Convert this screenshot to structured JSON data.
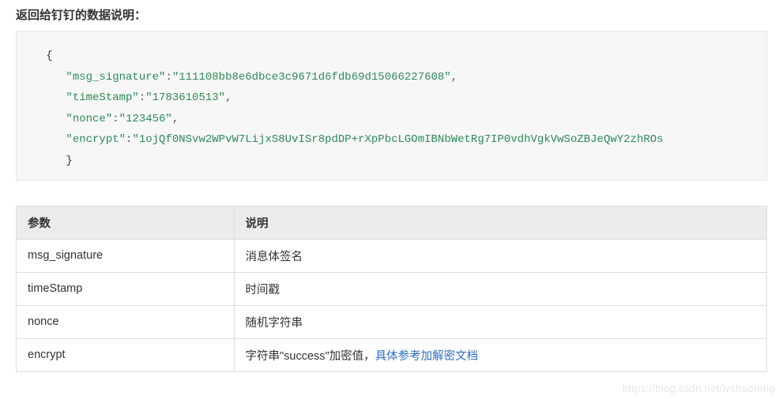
{
  "title": "返回给钉钉的数据说明：",
  "json_fields": {
    "msg_signature_key": "\"msg_signature\"",
    "msg_signature_val": "\"111108bb8e6dbce3c9671d6fdb69d15066227608\"",
    "timeStamp_key": "\"timeStamp\"",
    "timeStamp_val": "\"1783610513\"",
    "nonce_key": "\"nonce\"",
    "nonce_val": "\"123456\"",
    "encrypt_key": "\"encrypt\"",
    "encrypt_val": "\"1ojQf0NSvw2WPvW7LijxS8UvISr8pdDP+rXpPbcLGOmIBNbWetRg7IP0vdhVgkVwSoZBJeQwY2zhROs"
  },
  "table": {
    "headers": {
      "param": "参数",
      "desc": "说明"
    },
    "rows": [
      {
        "param": "msg_signature",
        "desc": "消息体签名"
      },
      {
        "param": "timeStamp",
        "desc": "时间戳"
      },
      {
        "param": "nonce",
        "desc": "随机字符串"
      },
      {
        "param": "encrypt",
        "desc_prefix": "字符串\"success\"加密值，",
        "link": "具体参考加解密文档"
      }
    ]
  },
  "watermark": "https://blog.csdn.net/lvshaorong"
}
